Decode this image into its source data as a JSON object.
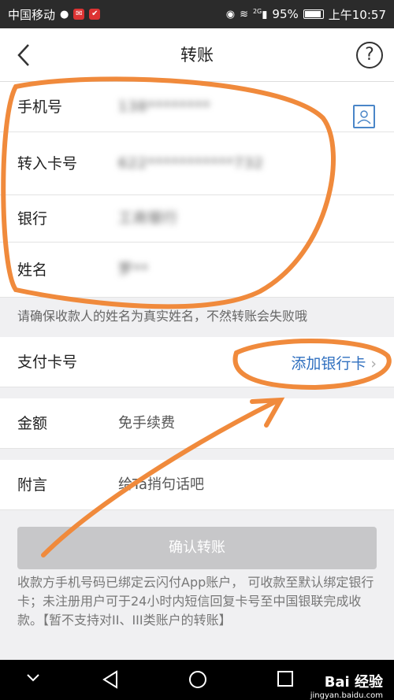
{
  "status_bar": {
    "carrier": "中国移动",
    "signal_tag": "2G",
    "battery": "95%",
    "time": "上午10:57"
  },
  "header": {
    "title": "转账",
    "back_icon": "chevron-left-icon",
    "help_icon": "question-circle-icon"
  },
  "payee": {
    "phone_label": "手机号",
    "phone_value": "138********",
    "card_label": "转入卡号",
    "card_value": "622***********732",
    "bank_label": "银行",
    "bank_value": "工商银行",
    "name_label": "姓名",
    "name_value": "罗**",
    "contact_icon": "contact-book-icon"
  },
  "notice": "请确保收款人的姓名为真实姓名，不然转账会失败哦",
  "payment": {
    "card_label": "支付卡号",
    "add_card": "添加银行卡"
  },
  "amount": {
    "label": "金额",
    "placeholder": "免手续费"
  },
  "memo": {
    "label": "附言",
    "placeholder": "给Ta捎句话吧"
  },
  "confirm_button": "确认转账",
  "tip": "收款方手机号码已绑定云闪付App账户， 可收款至默认绑定银行卡；未注册用户可于24小时内短信回复卡号至中国银联完成收款。【暂不支持对II、III类账户的转账】",
  "watermark": {
    "brand": "Bai 经验",
    "site": "jingyan.baidu.com"
  },
  "colors": {
    "accent": "#2f6fbf",
    "annotation": "#f08a3c",
    "button_disabled": "#c7c7c9"
  }
}
